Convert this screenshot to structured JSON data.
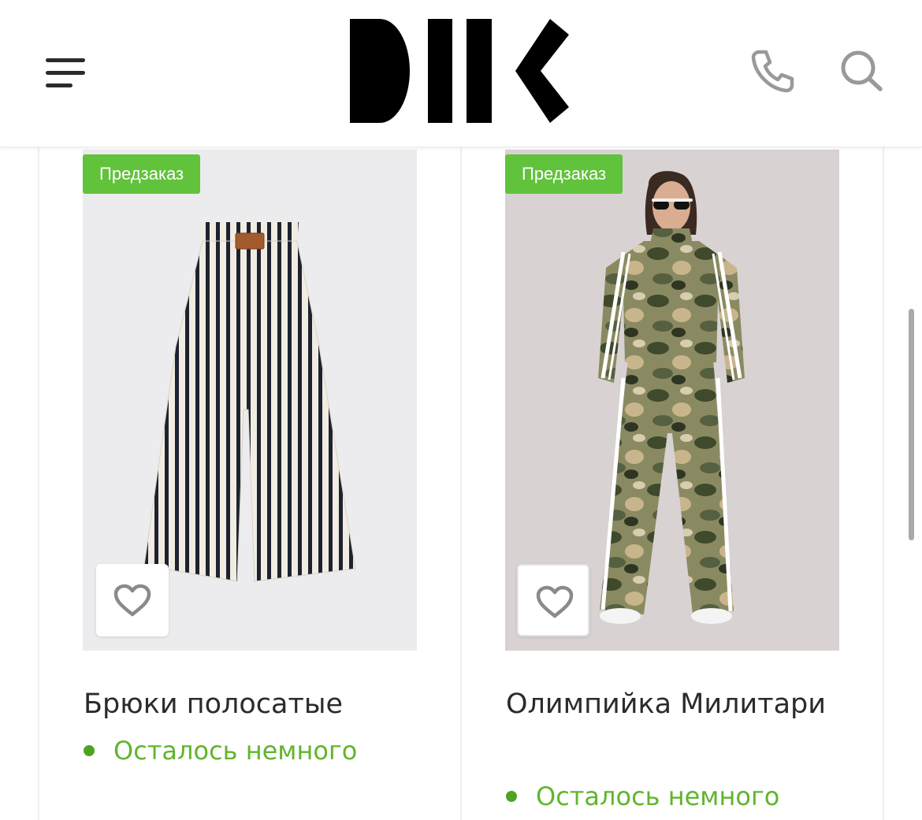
{
  "header": {
    "logo_text": "DIIK",
    "menu_icon": "hamburger-menu-icon",
    "phone_icon": "phone-icon",
    "search_icon": "search-icon"
  },
  "colors": {
    "accent_green": "#61c23c",
    "stock_green": "#61b52d",
    "text": "#2b2b2b"
  },
  "products": [
    {
      "badge": "Предзаказ",
      "title": "Брюки полосатые",
      "stock": "Осталось немного",
      "image": "striped-trousers-photo",
      "favorite_icon": "heart-icon"
    },
    {
      "badge": "Предзаказ",
      "title": "Олимпийка Милитари",
      "stock": "Осталось немного",
      "image": "camo-tracksuit-photo",
      "favorite_icon": "heart-icon"
    }
  ]
}
